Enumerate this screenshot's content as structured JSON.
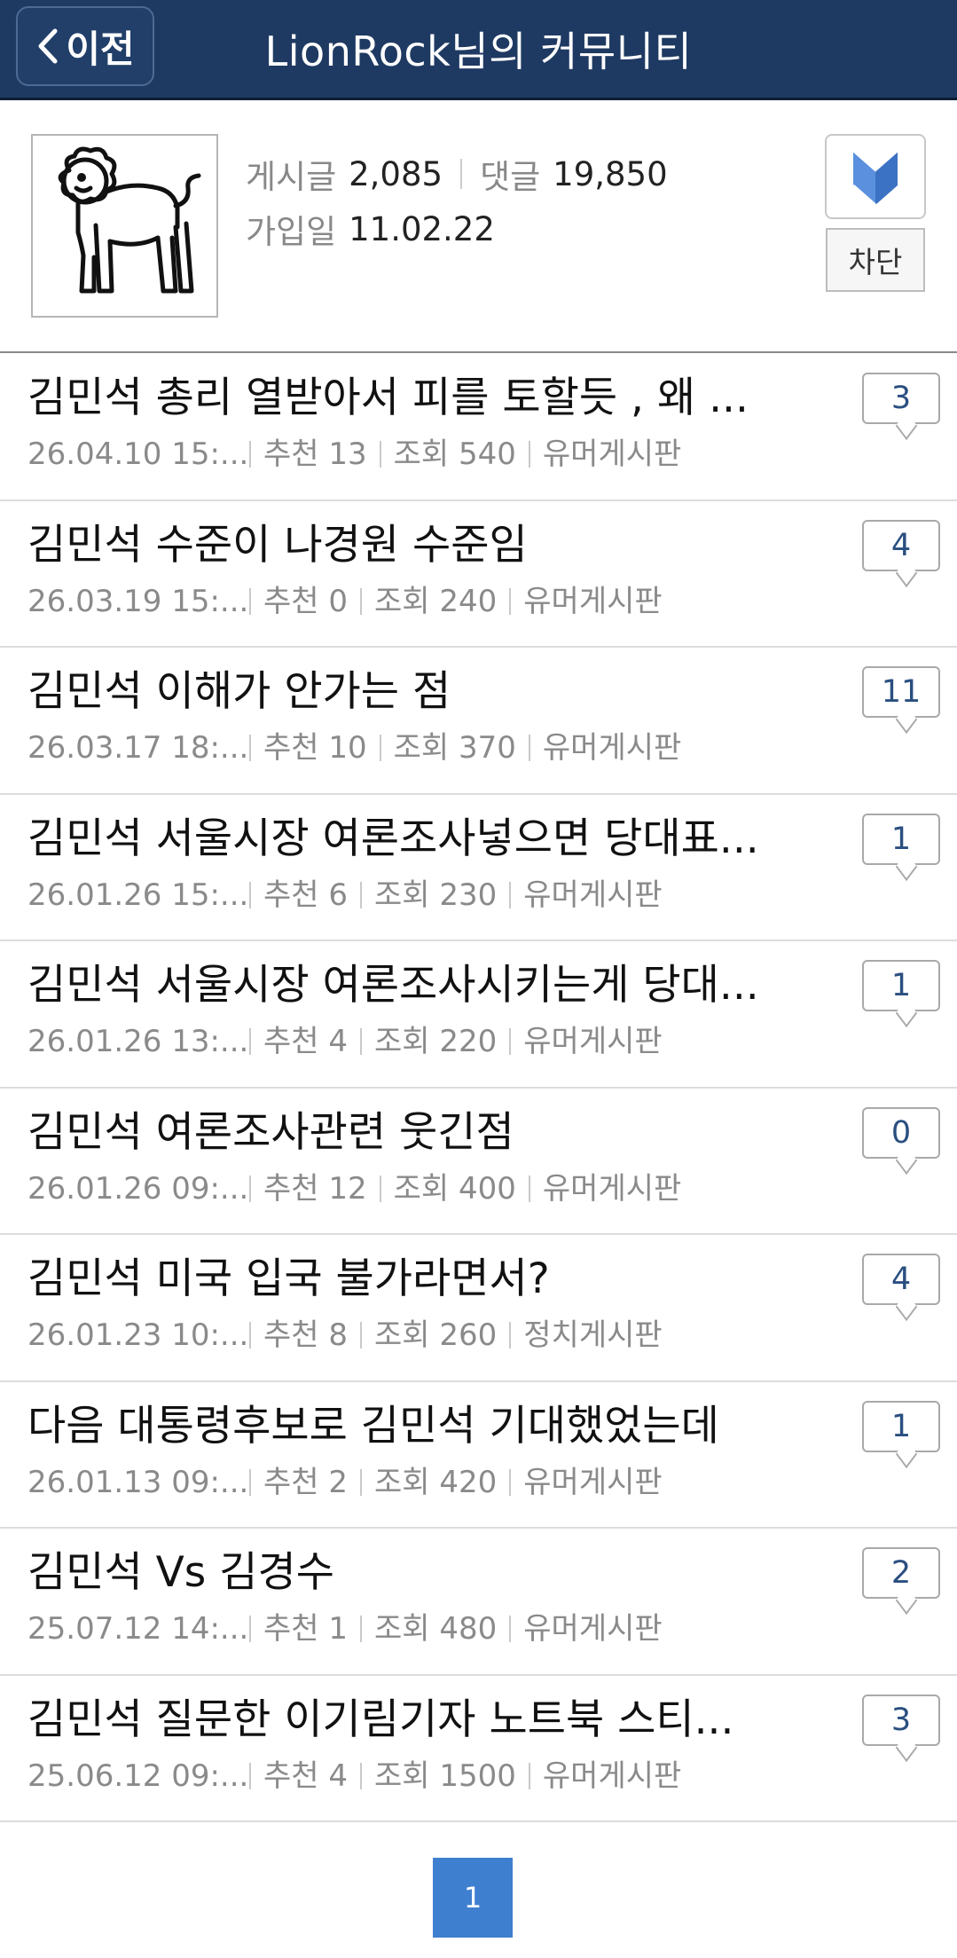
{
  "header": {
    "back_label": "이전",
    "title": "LionRock님의 커뮤니티"
  },
  "profile": {
    "posts_label": "게시글",
    "posts_value": "2,085",
    "comments_label": "댓글",
    "comments_value": "19,850",
    "joined_label": "가입일",
    "joined_value": "11.02.22",
    "block_label": "차단"
  },
  "posts": [
    {
      "title": "김민석 총리 열받아서 피를 토할듯 , 왜 ...",
      "date": "26.04.10  15:...",
      "likes": "추천 13",
      "views": "조회 540",
      "board": "유머게시판",
      "comments": "3"
    },
    {
      "title": "김민석 수준이 나경원 수준임",
      "date": "26.03.19  15:...",
      "likes": "추천 0",
      "views": "조회 240",
      "board": "유머게시판",
      "comments": "4"
    },
    {
      "title": "김민석 이해가 안가는 점",
      "date": "26.03.17  18:...",
      "likes": "추천 10",
      "views": "조회 370",
      "board": "유머게시판",
      "comments": "11"
    },
    {
      "title": "김민석 서울시장 여론조사넣으면 당대표...",
      "date": "26.01.26  15:...",
      "likes": "추천 6",
      "views": "조회 230",
      "board": "유머게시판",
      "comments": "1"
    },
    {
      "title": "김민석 서울시장 여론조사시키는게 당대...",
      "date": "26.01.26  13:...",
      "likes": "추천 4",
      "views": "조회 220",
      "board": "유머게시판",
      "comments": "1"
    },
    {
      "title": "김민석 여론조사관련 웃긴점",
      "date": "26.01.26  09:...",
      "likes": "추천 12",
      "views": "조회 400",
      "board": "유머게시판",
      "comments": "0"
    },
    {
      "title": "김민석 미국 입국 불가라면서?",
      "date": "26.01.23  10:...",
      "likes": "추천 8",
      "views": "조회 260",
      "board": "정치게시판",
      "comments": "4"
    },
    {
      "title": "다음 대통령후보로 김민석 기대했었는데",
      "date": "26.01.13  09:...",
      "likes": "추천 2",
      "views": "조회 420",
      "board": "유머게시판",
      "comments": "1"
    },
    {
      "title": "김민석 Vs 김경수",
      "date": "25.07.12  14:...",
      "likes": "추천 1",
      "views": "조회 480",
      "board": "유머게시판",
      "comments": "2"
    },
    {
      "title": "김민석 질문한 이기림기자 노트북 스티...",
      "date": "25.06.12  09:...",
      "likes": "추천 4",
      "views": "조회 1500",
      "board": "유머게시판",
      "comments": "3"
    }
  ],
  "pagination": {
    "current": "1"
  },
  "colors": {
    "header_bg": "#1f3a62",
    "pager_active": "#3f7fd0",
    "comment_count": "#2a4f80"
  }
}
